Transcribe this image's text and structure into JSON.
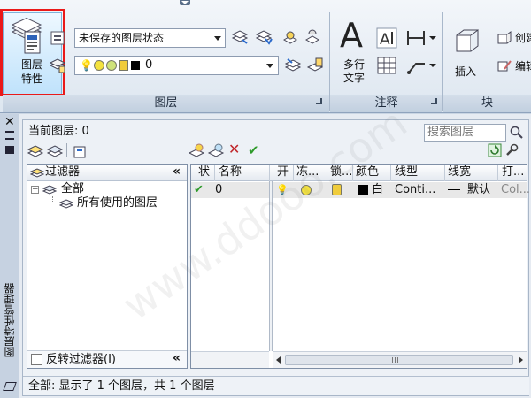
{
  "ribbon": {
    "layer_props_label_line1": "图层",
    "layer_props_label_line2": "特性",
    "layer_state_combo_value": "未保存的图层状态",
    "layer_combo_value": "0",
    "layers_panel_label": "图层",
    "mtext_label_line1": "多行",
    "mtext_label_line2": "文字",
    "annotation_panel_label": "注释",
    "insert_label": "插入",
    "create_label": "创建",
    "edit_label": "编辑",
    "block_panel_label": "块"
  },
  "palette": {
    "side_title": "图层特性管理器",
    "current_layer": "当前图层: 0",
    "search_placeholder": "搜索图层",
    "filter_header": "过滤器",
    "tree_all": "全部",
    "tree_used": "所有使用的图层",
    "invert_filter_label": "反转过滤器(I)",
    "columns": [
      "状",
      "名称",
      "开",
      "冻...",
      "锁...",
      "颜色",
      "线型",
      "线宽",
      "打..."
    ],
    "rows": [
      {
        "status": "✔",
        "name": "0",
        "color_name": "白",
        "linetype": "Conti...",
        "lineweight": "默认",
        "plot_style": "Col..."
      }
    ],
    "status_text": "全部: 显示了 1 个图层，共 1 个图层"
  },
  "watermark": "www.ddooo.com",
  "colors": {
    "accent_red": "#ea1919",
    "selected_blue": "#bfe2fb",
    "ribbon_bg": "#dde6f0"
  }
}
